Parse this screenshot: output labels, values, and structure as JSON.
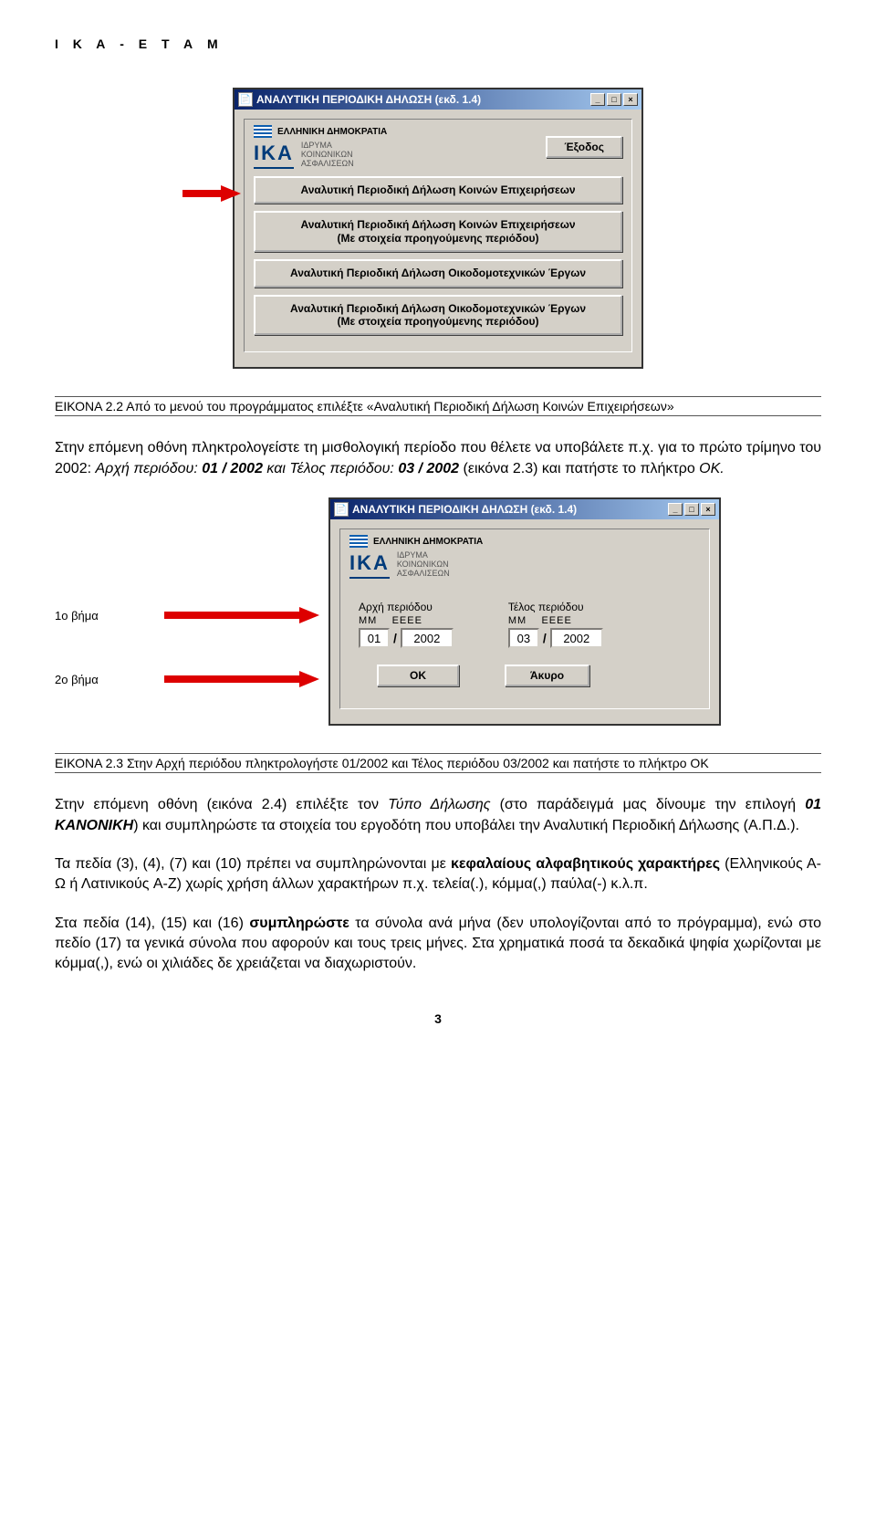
{
  "header": "Ι Κ Α - Ε Τ Α Μ",
  "window1": {
    "title": "ΑΝΑΛΥΤΙΚΗ ΠΕΡΙΟΔΙΚΗ ΔΗΛΩΣΗ (εκδ. 1.4)",
    "head_small": "ΕΛΛΗΝΙΚΗ ΔΗΜΟΚΡΑΤΙΑ",
    "logo": "IKA",
    "logo_line1": "ΙΔΡΥΜΑ",
    "logo_line2": "ΚΟΙΝΩΝΙΚΩΝ",
    "logo_line3": "ΑΣΦΑΛΙΣΕΩΝ",
    "exit_btn": "Έξοδος",
    "btn1": "Αναλυτική Περιοδική Δήλωση  Κοινών Επιχειρήσεων",
    "btn2_l1": "Αναλυτική Περιοδική Δήλωση Κοινών Επιχειρήσεων",
    "btn2_l2": "(Με στοιχεία προηγούμενης περιόδου)",
    "btn3": "Αναλυτική Περιοδική Δήλωση Οικοδομοτεχνικών Έργων",
    "btn4_l1": "Αναλυτική Περιοδική Δήλωση Οικοδομοτεχνικών Έργων",
    "btn4_l2": "(Με στοιχεία προηγούμενης περιόδου)",
    "min_glyph": "_",
    "max_glyph": "□",
    "close_glyph": "×"
  },
  "caption1": "ΕΙΚΟΝΑ 2.2 Από το μενού του προγράμματος επιλέξτε «Αναλυτική Περιοδική Δήλωση Κοινών Επιχειρήσεων»",
  "para1_a": "Στην επόμενη οθόνη πληκτρολογείστε τη μισθολογική περίοδο που θέλετε να υποβάλετε π.χ. για το πρώτο τρίμηνο του 2002: ",
  "para1_b": "Αρχή περιόδου: ",
  "para1_c": "01 / 2002",
  "para1_d": " και ",
  "para1_e": "Τέλος περιόδου: ",
  "para1_f": "03 / 2002 ",
  "para1_g": "(εικόνα 2.3) και πατήστε το πλήκτρο ",
  "para1_h": "ΟΚ.",
  "step1": "1ο βήμα",
  "step2": "2ο βήμα",
  "window2": {
    "title": "ΑΝΑΛΥΤΙΚΗ ΠΕΡΙΟΔΙΚΗ ΔΗΛΩΣΗ (εκδ. 1.4)",
    "head_small": "ΕΛΛΗΝΙΚΗ ΔΗΜΟΚΡΑΤΙΑ",
    "logo": "IKA",
    "logo_line1": "ΙΔΡΥΜΑ",
    "logo_line2": "ΚΟΙΝΩΝΙΚΩΝ",
    "logo_line3": "ΑΣΦΑΛΙΣΕΩΝ",
    "start_label": "Αρχή περιόδου",
    "end_label": "Τέλος περιόδου",
    "head_mm": "MM",
    "head_yyyy": "ΕΕΕΕ",
    "start_mm": "01",
    "start_yyyy": "2002",
    "end_mm": "03",
    "end_yyyy": "2002",
    "ok": "OK",
    "cancel": "Άκυρο",
    "min_glyph": "_",
    "max_glyph": "□",
    "close_glyph": "×"
  },
  "caption2": "ΕΙΚΟΝΑ 2.3 Στην Αρχή περιόδου πληκτρολογήστε 01/2002 και Τέλος περιόδου 03/2002 και πατήστε το πλήκτρο ΟΚ",
  "para2_a": "Στην επόμενη οθόνη (εικόνα 2.4) επιλέξτε τον ",
  "para2_b": "Τύπο Δήλωσης ",
  "para2_c": "(στο παράδειγμά μας δίνουμε την επιλογή ",
  "para2_d": "01 ΚΑΝΟΝΙΚΗ",
  "para2_e": ") και συμπληρώστε τα στοιχεία του εργοδότη που υποβάλει την Αναλυτική Περιοδική Δήλωσης (Α.Π.Δ.).",
  "para3_a": "Τα πεδία (3), (4), (7) και (10) πρέπει να συμπληρώνονται με ",
  "para3_b": "κεφαλαίους αλφαβητικούς χαρακτήρες",
  "para3_c": " (Ελληνικούς Α-Ω ή Λατινικούς A-Z) χωρίς χρήση άλλων χαρακτήρων π.χ. τελεία(.), κόμμα(,) παύλα(-) κ.λ.π.",
  "para4_a": "Στα πεδία (14), (15) και (16) ",
  "para4_b": "συμπληρώστε",
  "para4_c": " τα σύνολα ανά μήνα (δεν υπολογίζονται από το πρόγραμμα), ενώ στο πεδίο (17) τα γενικά σύνολα που αφορούν και τους τρεις μήνες. Στα χρηματικά ποσά τα δεκαδικά ψηφία χωρίζονται με κόμμα(,), ενώ οι χιλιάδες δε χρειάζεται να διαχωριστούν.",
  "page_number": "3"
}
